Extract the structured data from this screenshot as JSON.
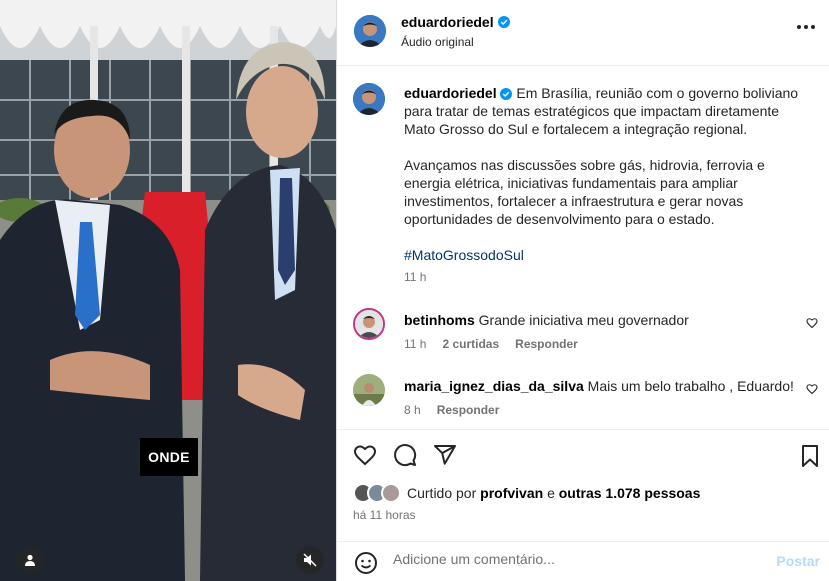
{
  "media": {
    "overlay_caption": "ONDE",
    "user_icon": "user-icon",
    "mute_icon": "speaker-muted-icon"
  },
  "header": {
    "username": "eduardoriedel",
    "verified": true,
    "audio": "Áudio original",
    "more_icon": "more-horizontal-icon"
  },
  "post": {
    "username": "eduardoriedel",
    "paragraph1": "Em Brasília, reunião com o governo boliviano para tratar de temas estratégicos que impactam diretamente Mato Grosso do Sul e fortalecem a integração regional.",
    "paragraph2": "Avançamos nas discussões sobre gás, hidrovia, ferrovia e energia elétrica, iniciativas fundamentais para ampliar investimentos, fortalecer a infraestrutura e gerar novas oportunidades de desenvolvimento para o estado.",
    "hashtag": "#MatoGrossodoSul",
    "time": "11 h"
  },
  "comments": [
    {
      "username": "betinhoms",
      "text": "Grande iniciativa meu governador",
      "time": "11 h",
      "likes": "2 curtidas",
      "reply": "Responder"
    },
    {
      "username": "maria_ignez_dias_da_silva",
      "text": "Mais um belo trabalho , Eduardo!",
      "time": "8 h",
      "reply": "Responder"
    }
  ],
  "actions": {
    "icons": [
      "heart-icon",
      "comment-icon",
      "share-icon",
      "bookmark-icon"
    ],
    "liked_by_prefix": "Curtido por",
    "liked_by_user": "profvivan",
    "liked_by_conj": "e",
    "liked_by_others": "outras 1.078 pessoas",
    "time_ago": "há 11 horas"
  },
  "add_comment": {
    "placeholder": "Adicione um comentário...",
    "post_label": "Postar",
    "emoji_icon": "emoji-icon"
  },
  "colors": {
    "link": "#00376b",
    "post_button": "#b3dbff",
    "verified": "#0095f6",
    "carpet": "#d9202a"
  }
}
